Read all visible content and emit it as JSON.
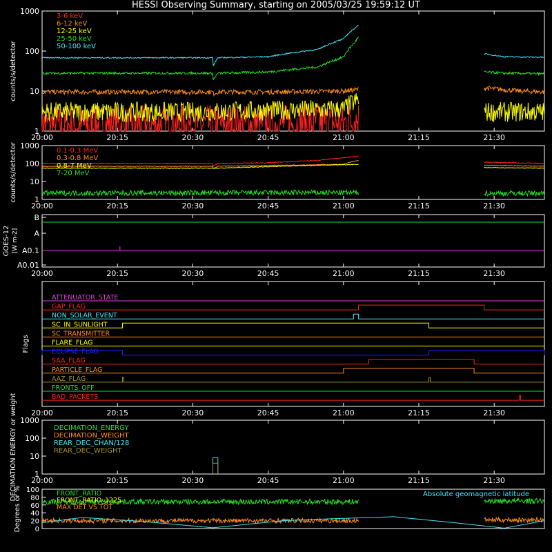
{
  "title": "HESSI Observing Summary, starting on 2005/03/25 19:59:12 UT",
  "colors": {
    "background": "#000000",
    "axes": "#ffffff",
    "red": "#ff2020",
    "orange": "#ff8c1a",
    "yellow": "#ffff00",
    "green": "#22e022",
    "cyan": "#40e8ff",
    "magenta": "#e040e0",
    "blue": "#2020ff",
    "olive": "#a09030"
  },
  "chart_data": [
    {
      "type": "line",
      "panel": "hxr",
      "ylabel": "counts/s/detector",
      "yscale": "log",
      "ylim": [
        1,
        1000
      ],
      "ytick_labels": [
        "1",
        "10",
        "100",
        "1000"
      ],
      "xlim_minutes_ut": [
        "20:00",
        "21:40"
      ],
      "xtick_labels": [
        "20:00",
        "20:15",
        "20:30",
        "20:45",
        "21:00",
        "21:15",
        "21:30"
      ],
      "legend": [
        "3-6 keV",
        "6-12 keV",
        "12-25 keV",
        "25-50 keV",
        "50-100 keV"
      ],
      "series": [
        {
          "name": "3-6 keV",
          "color": "red",
          "segments": [
            {
              "x": [
                "20:00",
                "20:30",
                "21:00",
                "21:03"
              ],
              "y": [
                1.4,
                1.4,
                1.6,
                2.0
              ],
              "noise": 0.5
            }
          ]
        },
        {
          "name": "6-12 keV",
          "color": "orange",
          "segments": [
            {
              "x": [
                "20:00",
                "20:34",
                "20:34",
                "20:35",
                "20:45",
                "21:00",
                "21:03"
              ],
              "y": [
                9.5,
                9.5,
                8.5,
                9.5,
                9.5,
                10,
                11
              ],
              "noise": 0.06
            },
            {
              "x": [
                "21:28",
                "21:35",
                "21:40"
              ],
              "y": [
                12,
                10,
                9.5
              ],
              "noise": 0.06
            }
          ]
        },
        {
          "name": "12-25 keV",
          "color": "yellow",
          "segments": [
            {
              "x": [
                "20:00",
                "20:30",
                "21:00",
                "21:03"
              ],
              "y": [
                3,
                3,
                3.5,
                6
              ],
              "noise": 0.25
            },
            {
              "x": [
                "21:28",
                "21:40"
              ],
              "y": [
                3,
                3
              ],
              "noise": 0.25
            }
          ]
        },
        {
          "name": "25-50 keV",
          "color": "green",
          "segments": [
            {
              "x": [
                "20:00",
                "20:34",
                "20:34",
                "20:35",
                "20:45",
                "20:55",
                "21:00",
                "21:02",
                "21:03"
              ],
              "y": [
                28,
                28,
                18,
                28,
                30,
                40,
                70,
                150,
                220
              ],
              "noise": 0.03
            },
            {
              "x": [
                "21:28",
                "21:32",
                "21:40"
              ],
              "y": [
                30,
                28,
                27
              ],
              "noise": 0.03
            }
          ]
        },
        {
          "name": "50-100 keV",
          "color": "cyan",
          "segments": [
            {
              "x": [
                "20:00",
                "20:34",
                "20:34",
                "20:35",
                "20:45",
                "20:55",
                "21:00",
                "21:02",
                "21:03"
              ],
              "y": [
                68,
                68,
                40,
                68,
                72,
                110,
                200,
                350,
                450
              ],
              "noise": 0.015
            },
            {
              "x": [
                "21:28",
                "21:32",
                "21:40"
              ],
              "y": [
                85,
                72,
                70
              ],
              "noise": 0.015
            }
          ]
        }
      ]
    },
    {
      "type": "line",
      "panel": "gamma",
      "ylabel": "counts/s/detector",
      "yscale": "log",
      "ylim": [
        1,
        1000
      ],
      "ytick_labels": [
        "1",
        "10",
        "100",
        "1000"
      ],
      "xtick_labels": [
        "20:00",
        "20:15",
        "20:30",
        "20:45",
        "21:00",
        "21:15",
        "21:30"
      ],
      "legend": [
        "0.1-0.3 MeV",
        "0.3-0.8 MeV",
        "0.8-7 MeV",
        "7-20 MeV"
      ],
      "series": [
        {
          "name": "0.1-0.3 MeV",
          "color": "red",
          "segments": [
            {
              "x": [
                "20:00",
                "20:34",
                "20:34",
                "20:35",
                "20:45",
                "20:55",
                "21:03"
              ],
              "y": [
                100,
                100,
                70,
                100,
                110,
                150,
                250
              ],
              "noise": 0.02
            },
            {
              "x": [
                "21:28",
                "21:40"
              ],
              "y": [
                120,
                100
              ],
              "noise": 0.02
            }
          ]
        },
        {
          "name": "0.3-0.8 MeV",
          "color": "orange",
          "segments": [
            {
              "x": [
                "20:00",
                "20:34",
                "20:34",
                "20:35",
                "21:00",
                "21:03"
              ],
              "y": [
                70,
                70,
                50,
                70,
                90,
                150
              ],
              "noise": 0.02
            },
            {
              "x": [
                "21:28",
                "21:40"
              ],
              "y": [
                80,
                70
              ],
              "noise": 0.02
            }
          ]
        },
        {
          "name": "0.8-7 MeV",
          "color": "yellow",
          "segments": [
            {
              "x": [
                "20:00",
                "20:34",
                "20:35",
                "21:03"
              ],
              "y": [
                55,
                55,
                55,
                90
              ],
              "noise": 0.02
            },
            {
              "x": [
                "21:28",
                "21:40"
              ],
              "y": [
                60,
                55
              ],
              "noise": 0.02
            }
          ]
        },
        {
          "name": "7-20 MeV",
          "color": "green",
          "segments": [
            {
              "x": [
                "20:00",
                "21:03"
              ],
              "y": [
                2.2,
                2.4
              ],
              "noise": 0.15
            },
            {
              "x": [
                "21:28",
                "21:40"
              ],
              "y": [
                2.2,
                2.2
              ],
              "noise": 0.15
            }
          ]
        }
      ]
    },
    {
      "type": "line",
      "panel": "goes",
      "ylabel": "GOES-12 [W m-2]",
      "ytick_labels": [
        "B",
        "A",
        "A0.1",
        "A0.01"
      ],
      "xtick_labels": [
        "20:00",
        "20:15",
        "20:30",
        "20:45",
        "21:00",
        "21:15",
        "21:30"
      ],
      "series": [
        {
          "color": "green",
          "level": "B"
        },
        {
          "color": "magenta",
          "level": "A0.1"
        }
      ]
    },
    {
      "type": "line",
      "panel": "flags",
      "ylabel": "Flags",
      "xtick_labels": [
        "20:00",
        "20:15",
        "20:30",
        "20:45",
        "21:00",
        "21:15",
        "21:30"
      ],
      "flags": [
        {
          "name": "ATTENUATOR_STATE",
          "color": "magenta",
          "on": []
        },
        {
          "name": "GAP_FLAG",
          "color": "red",
          "on": [
            [
              "21:03",
              "21:28"
            ]
          ]
        },
        {
          "name": "NON_SOLAR_EVENT",
          "color": "cyan",
          "on": [
            [
              "21:02",
              "21:03"
            ]
          ]
        },
        {
          "name": "SC_IN_SUNLIGHT",
          "color": "yellow",
          "on": [
            [
              "20:16",
              "21:17"
            ]
          ]
        },
        {
          "name": "SC_TRANSMITTER",
          "color": "orange",
          "on": []
        },
        {
          "name": "FLARE_FLAG",
          "color": "yellow",
          "on": []
        },
        {
          "name": "ECLIPSE_FLAG",
          "color": "blue",
          "on": [
            [
              "20:00",
              "20:16"
            ],
            [
              "21:17",
              "21:40"
            ]
          ]
        },
        {
          "name": "SAA_FLAG",
          "color": "red",
          "on": [
            [
              "21:05",
              "21:26"
            ]
          ]
        },
        {
          "name": "PARTICLE_FLAG",
          "color": "orange",
          "on": [
            [
              "21:00",
              "21:26"
            ]
          ]
        },
        {
          "name": "AAZ_FLAG",
          "color": "olive",
          "on": [
            [
              "20:16",
              "20:16"
            ],
            [
              "21:17",
              "21:17"
            ]
          ]
        },
        {
          "name": "FRONTS_OFF",
          "color": "green",
          "on": []
        },
        {
          "name": "BAD_PACKETS",
          "color": "red",
          "on": [
            [
              "21:35",
              "21:35"
            ]
          ]
        }
      ]
    },
    {
      "type": "line",
      "panel": "decimation",
      "ylabel": "DECIMATION ENERGY or weight",
      "yscale": "log",
      "ylim": [
        1,
        1000
      ],
      "ytick_labels": [
        "1",
        "10",
        "100",
        "1000"
      ],
      "xtick_labels": [
        "20:00",
        "20:15",
        "20:30",
        "20:45",
        "21:00",
        "21:15",
        "21:30"
      ],
      "legend": [
        "DECIMATION_ENERGY",
        "DECIMATION_WEIGHT",
        "REAR_DEC_CHAN/128",
        "REAR_DEC_WEIGHT"
      ],
      "series": [
        {
          "name": "REAR_DEC_CHAN/128",
          "color": "cyan",
          "spike": [
            "20:34",
            "20:35"
          ],
          "y": 8
        },
        {
          "name": "REAR_DEC_WEIGHT",
          "color": "olive",
          "spike": [
            "20:34",
            "20:35"
          ],
          "y": 4
        }
      ]
    },
    {
      "type": "line",
      "panel": "ratios",
      "ylabel": "Degrees or %",
      "ylim": [
        0,
        100
      ],
      "ytick_labels": [
        "0",
        "20",
        "40",
        "60",
        "80",
        "100"
      ],
      "legend": [
        "FRONT_RATIO",
        "FRONT_RATIO_1225",
        "MAX DET VS TOT"
      ],
      "annotation": "Absolute geomagnetic latitude",
      "series": [
        {
          "name": "FRONT_RATIO",
          "color": "green",
          "segments": [
            {
              "x": [
                "20:00",
                "21:03"
              ],
              "y": [
                68,
                68
              ],
              "noise": 7
            },
            {
              "x": [
                "21:28",
                "21:40"
              ],
              "y": [
                70,
                70
              ],
              "noise": 7
            }
          ]
        },
        {
          "name": "FRONT_RATIO_1225",
          "color": "orange",
          "segments": [
            {
              "x": [
                "20:00",
                "21:03"
              ],
              "y": [
                20,
                20
              ],
              "noise": 6
            },
            {
              "x": [
                "21:28",
                "21:40"
              ],
              "y": [
                22,
                22
              ],
              "noise": 6
            }
          ]
        },
        {
          "name": "Absolute geomagnetic latitude",
          "color": "cyan",
          "segments": [
            {
              "x": [
                "20:00",
                "20:08",
                "20:20",
                "20:34",
                "20:48",
                "20:58",
                "21:10",
                "21:22",
                "21:32",
                "21:40"
              ],
              "y": [
                15,
                28,
                18,
                2,
                20,
                25,
                30,
                15,
                1,
                20
              ],
              "noise": 0
            }
          ]
        }
      ]
    }
  ]
}
